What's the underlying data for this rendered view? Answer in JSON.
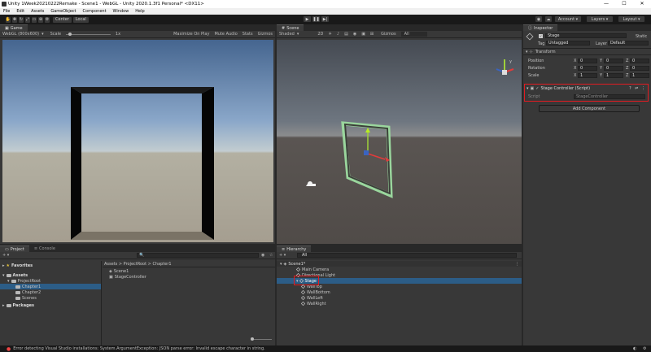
{
  "window": {
    "title": "Unity 1Week20210222Remake - Scene1 - WebGL - Unity 2020.1.3f1 Personal* <DX11>",
    "min": "—",
    "max": "☐",
    "close": "✕"
  },
  "menu": [
    "File",
    "Edit",
    "Assets",
    "GameObject",
    "Component",
    "Window",
    "Help"
  ],
  "toolbar": {
    "center": "Center",
    "local": "Local",
    "account": "Account",
    "layers": "Layers",
    "layout": "Layout"
  },
  "game": {
    "tab": "Game",
    "display": "WebGL (800x600)",
    "scale_label": "Scale",
    "scale_value": "1x",
    "maximize": "Maximize On Play",
    "mute": "Mute Audio",
    "stats": "Stats",
    "gizmos": "Gizmos"
  },
  "scene": {
    "tab": "Scene",
    "shading": "Shaded",
    "mode2d": "2D",
    "gizmos": "Gizmos",
    "search": "All"
  },
  "inspector": {
    "tab": "Inspector",
    "name": "Stage",
    "static": "Static",
    "tag_label": "Tag",
    "tag_value": "Untagged",
    "layer_label": "Layer",
    "layer_value": "Default",
    "transform": "Transform",
    "rows": [
      {
        "label": "Position",
        "x": "0",
        "y": "0",
        "z": "0"
      },
      {
        "label": "Rotation",
        "x": "0",
        "y": "0",
        "z": "0"
      },
      {
        "label": "Scale",
        "x": "1",
        "y": "1",
        "z": "1"
      }
    ],
    "component": "Stage Controller (Script)",
    "script_label": "Script",
    "script_value": "StageController",
    "add_component": "Add Component"
  },
  "project": {
    "tab": "Project",
    "tab2": "Console",
    "favorites": "Favorites",
    "assets": "Assets",
    "root": "ProjectRoot",
    "folders": [
      "Chapter1",
      "Chapter2",
      "Scenes"
    ],
    "packages": "Packages",
    "breadcrumb": "Assets > ProjectRoot > Chapter1",
    "files": [
      "Scene1",
      "StageController"
    ],
    "count": "10"
  },
  "hierarchy": {
    "tab": "Hierarchy",
    "search": "All",
    "scene": "Scene1*",
    "items": [
      "Main Camera",
      "Directional Light",
      "Stage",
      "WallTop",
      "WallBottom",
      "WallLeft",
      "WallRight"
    ]
  },
  "status": "Error detecting Visual Studio installations: System.ArgumentException: JSON parse error: Invalid escape character in string.",
  "colors": {
    "selection": "#2c5d87",
    "highlight": "#e21b22"
  }
}
